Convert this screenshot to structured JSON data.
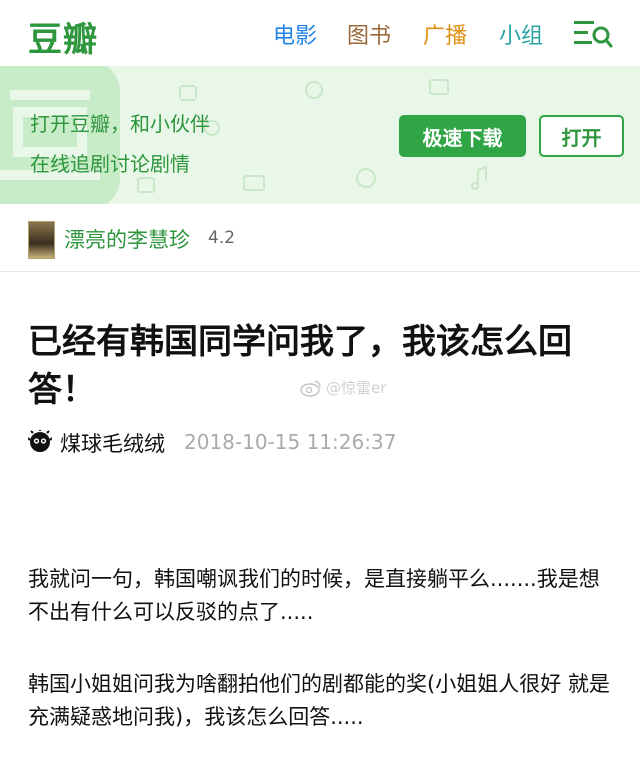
{
  "header": {
    "logo": "豆瓣",
    "nav": [
      "电影",
      "图书",
      "广播",
      "小组"
    ],
    "menu_icon": "menu-search-icon"
  },
  "banner": {
    "line1": "打开豆瓣，和小伙伴",
    "line2": "在线追剧讨论剧情",
    "download_label": "极速下载",
    "open_label": "打开"
  },
  "show": {
    "title": "漂亮的李慧珍",
    "rating": "4.2"
  },
  "article": {
    "title": "已经有韩国同学问我了，我该怎么回答！",
    "author": "煤球毛绒绒",
    "time": "2018-10-15 11:26:37",
    "paragraphs": [
      "我就问一句，韩国嘲讽我们的时候，是直接躺平么.......我是想不出有什么可以反驳的点了.....",
      "韩国小姐姐问我为啥翻拍他们的剧都能的奖(小姐姐人很好 就是充满疑惑地问我)，我该怎么回答....."
    ]
  },
  "watermark": "@惊雷er",
  "colors": {
    "brand_green": "#2e963d",
    "banner_bg": "#e8f7e8",
    "nav_movie": "#2384e8",
    "nav_book": "#9b6a3c",
    "nav_radio": "#e09015",
    "nav_group": "#2aa3a2"
  }
}
